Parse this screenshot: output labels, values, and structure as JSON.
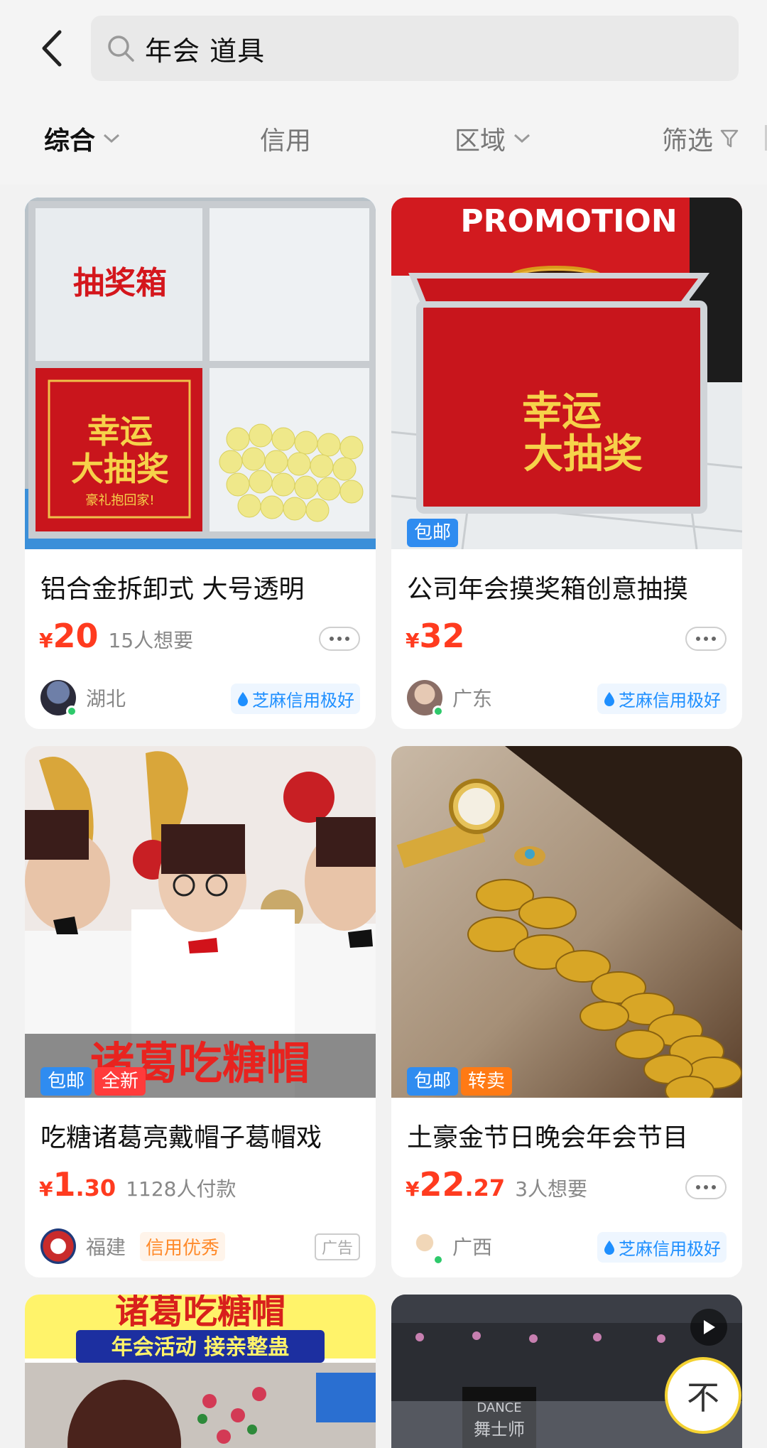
{
  "search": {
    "query": "年会 道具"
  },
  "filters": [
    {
      "label": "综合",
      "has_chevron": true,
      "active": true
    },
    {
      "label": "信用",
      "has_chevron": false,
      "active": false
    },
    {
      "label": "区域",
      "has_chevron": true,
      "active": false
    },
    {
      "label": "筛选",
      "has_chevron": false,
      "active": false
    }
  ],
  "colors": {
    "price": "#ff3b1f",
    "credit_blue": "#1e8fff",
    "badge_blue": "#2f8cf0",
    "badge_red": "#ff3b3b",
    "badge_orange": "#ff7a14",
    "to_top_ring": "#f4d232"
  },
  "products": [
    {
      "title": "铝合金拆卸式 大号透明",
      "price_int": "20",
      "price_dec": "",
      "want": "15人想要",
      "region": "湖北",
      "credit": "芝麻信用极好",
      "badges": [],
      "image_text": [
        "抽奖箱",
        "幸运",
        "大抽奖",
        "豪礼抱回家!"
      ]
    },
    {
      "title": "公司年会摸奖箱创意抽摸",
      "price_int": "32",
      "price_dec": "",
      "want": "",
      "region": "广东",
      "credit": "芝麻信用极好",
      "badges": [
        "包邮"
      ],
      "image_text": [
        "PROMOTION",
        "幸运",
        "大抽奖"
      ]
    },
    {
      "title": "吃糖诸葛亮戴帽子葛帽戏",
      "price_int": "1",
      "price_dec": ".30",
      "want": "1128人付款",
      "region": "福建",
      "credit": "信用优秀",
      "ad": "广告",
      "badges": [
        "包邮",
        "全新"
      ],
      "image_text": [
        "诸葛吃糖帽"
      ]
    },
    {
      "title": "土豪金节日晚会年会节目",
      "price_int": "22",
      "price_dec": ".27",
      "want": "3人想要",
      "region": "广西",
      "credit": "芝麻信用极好",
      "badges": [
        "包邮",
        "转卖"
      ],
      "image_text": []
    },
    {
      "title": "",
      "image_text": [
        "诸葛吃糖帽",
        "年会活动 接亲整蛊"
      ]
    },
    {
      "title": "",
      "image_text": [
        "DANCE",
        "舞士师"
      ]
    }
  ],
  "price_symbol": "¥",
  "to_top_label": "不"
}
